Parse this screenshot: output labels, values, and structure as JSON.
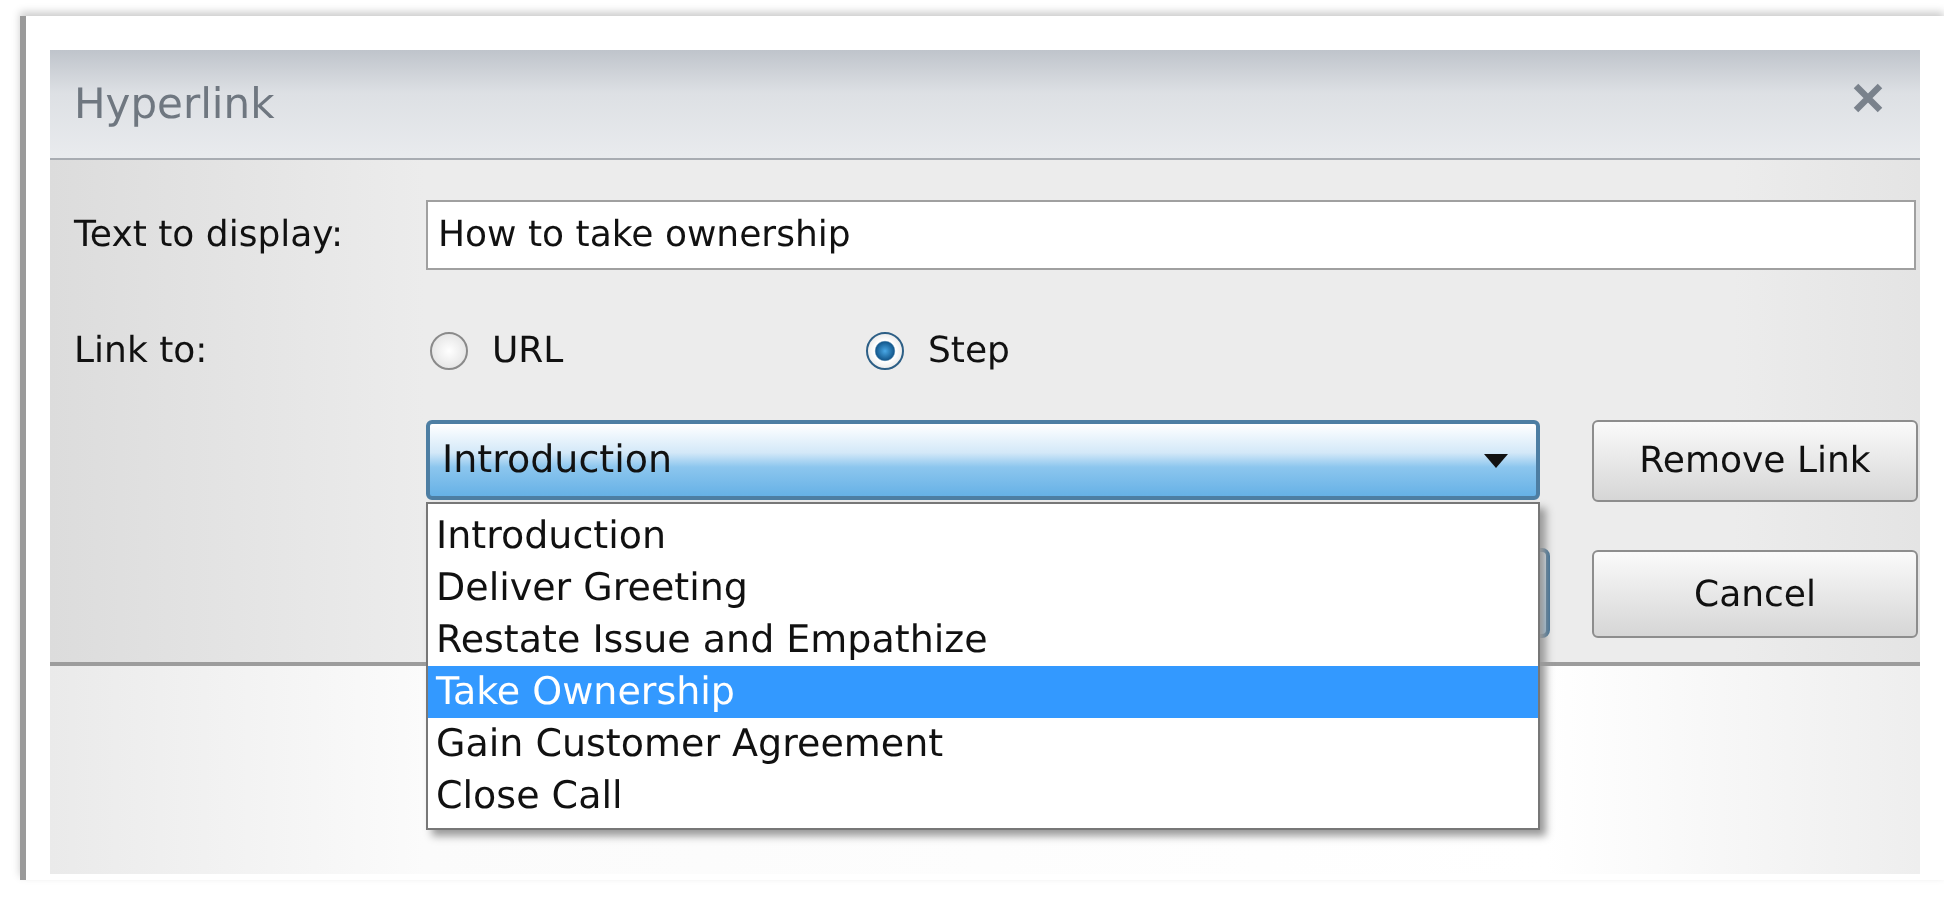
{
  "window": {
    "title": "Hyperlink"
  },
  "text_to_display": {
    "label": "Text to display:",
    "value": "How to take ownership"
  },
  "link_to": {
    "label": "Link to:",
    "options": [
      {
        "label": "URL",
        "selected": false
      },
      {
        "label": "Step",
        "selected": true
      }
    ]
  },
  "step_dropdown": {
    "value": "Introduction",
    "expanded": true,
    "items": [
      {
        "label": "Introduction",
        "highlighted": false
      },
      {
        "label": "Deliver Greeting",
        "highlighted": false
      },
      {
        "label": "Restate Issue and Empathize",
        "highlighted": false
      },
      {
        "label": "Take Ownership",
        "highlighted": true
      },
      {
        "label": "Gain Customer Agreement",
        "highlighted": false
      },
      {
        "label": "Close Call",
        "highlighted": false
      }
    ]
  },
  "buttons": [
    {
      "label": "Remove Link"
    },
    {
      "label": "Cancel"
    }
  ]
}
